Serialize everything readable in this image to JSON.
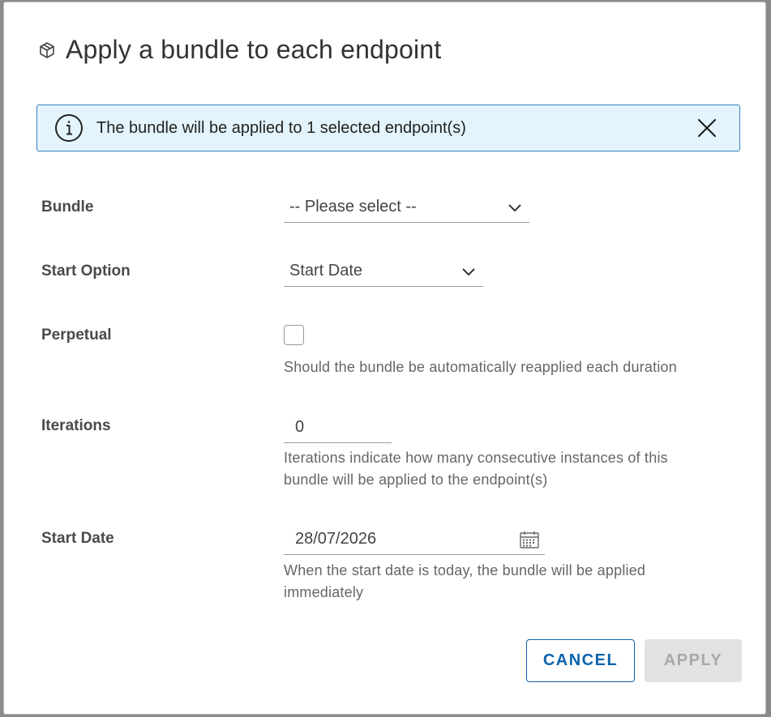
{
  "dialog": {
    "title": "Apply a bundle to each endpoint",
    "title_icon": "package-icon"
  },
  "alert": {
    "message": "The bundle will be applied to 1 selected endpoint(s)",
    "icon": "info-icon",
    "close_icon": "close-icon",
    "background": "#e3f4fd",
    "border": "#3b82c4"
  },
  "form": {
    "bundle": {
      "label": "Bundle",
      "value": "-- Please select --"
    },
    "start_option": {
      "label": "Start Option",
      "value": "Start Date"
    },
    "perpetual": {
      "label": "Perpetual",
      "checked": false,
      "help": "Should the bundle be automatically reapplied each duration"
    },
    "iterations": {
      "label": "Iterations",
      "value": "0",
      "help_line1": "Iterations indicate how many consecutive instances of this",
      "help_line2": "bundle will be applied to the endpoint(s)"
    },
    "start_date": {
      "label": "Start Date",
      "value": "28/07/2026",
      "help_line1": "When the start date is today, the bundle will be applied",
      "help_line2": "immediately"
    }
  },
  "buttons": {
    "cancel_label": "CANCEL",
    "apply_label": "APPLY",
    "primary_color": "#0b63ad"
  }
}
